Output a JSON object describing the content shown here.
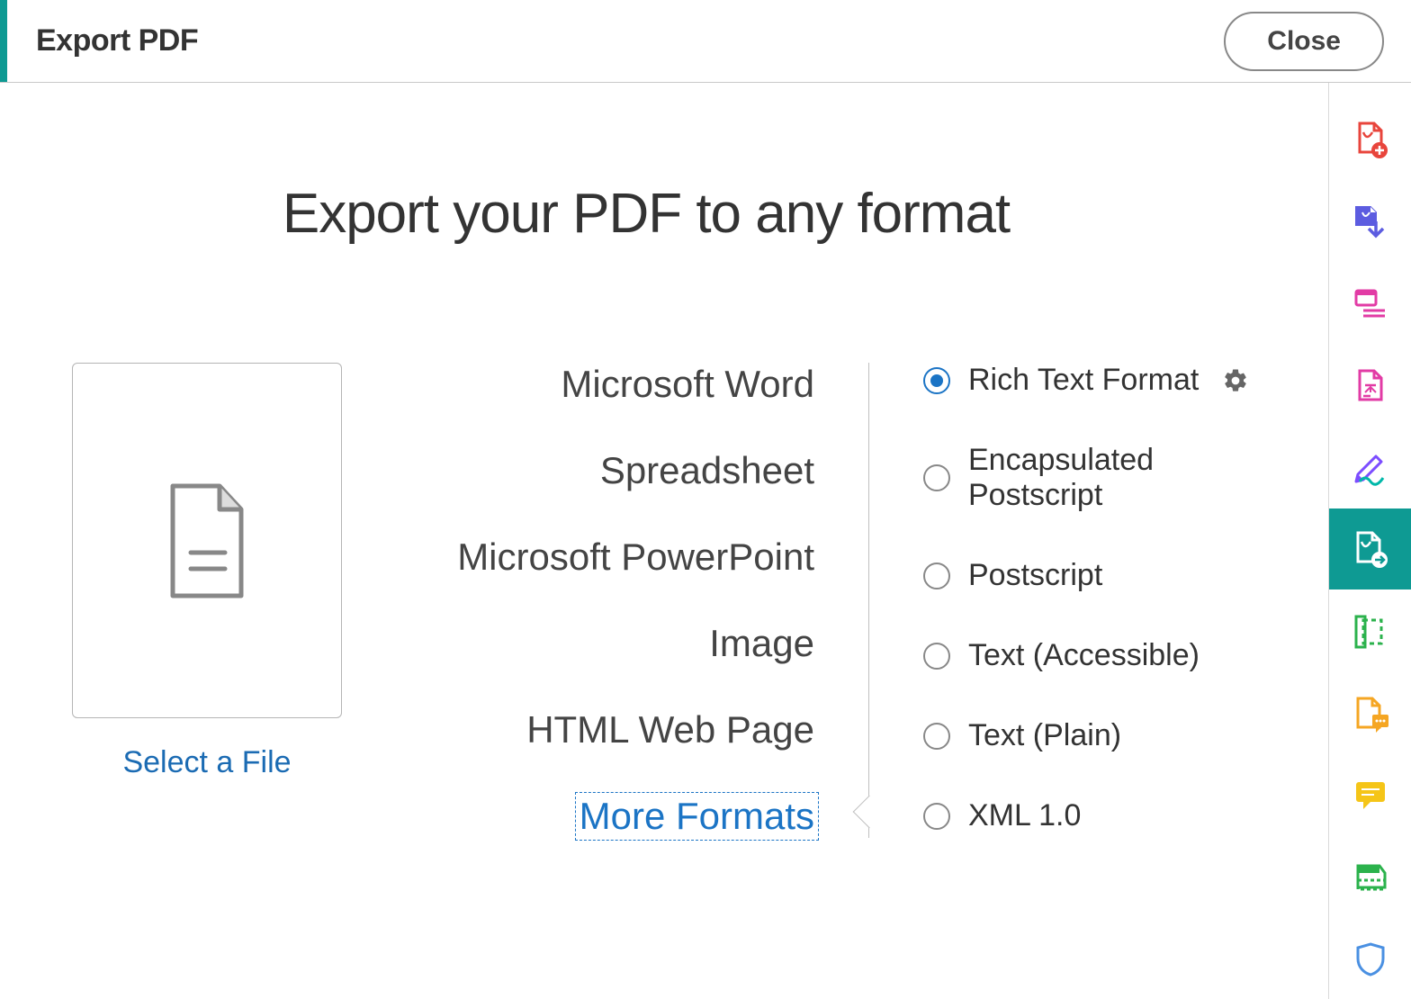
{
  "header": {
    "title": "Export PDF",
    "close_label": "Close"
  },
  "main": {
    "heading": "Export your PDF to any format",
    "select_file_label": "Select a File",
    "categories": [
      {
        "label": "Microsoft Word",
        "selected": false
      },
      {
        "label": "Spreadsheet",
        "selected": false
      },
      {
        "label": "Microsoft PowerPoint",
        "selected": false
      },
      {
        "label": "Image",
        "selected": false
      },
      {
        "label": "HTML Web Page",
        "selected": false
      },
      {
        "label": "More Formats",
        "selected": true
      }
    ],
    "options": [
      {
        "label": "Rich Text Format",
        "checked": true,
        "has_settings": true
      },
      {
        "label": "Encapsulated Postscript",
        "checked": false,
        "has_settings": false
      },
      {
        "label": "Postscript",
        "checked": false,
        "has_settings": false
      },
      {
        "label": "Text (Accessible)",
        "checked": false,
        "has_settings": false
      },
      {
        "label": "Text (Plain)",
        "checked": false,
        "has_settings": false
      },
      {
        "label": "XML 1.0",
        "checked": false,
        "has_settings": false
      }
    ]
  },
  "tool_rail": {
    "items": [
      {
        "name": "create-pdf-icon",
        "active": false
      },
      {
        "name": "combine-files-icon",
        "active": false
      },
      {
        "name": "organize-pages-icon",
        "active": false
      },
      {
        "name": "edit-pdf-icon",
        "active": false
      },
      {
        "name": "sign-icon",
        "active": false
      },
      {
        "name": "export-pdf-icon",
        "active": true
      },
      {
        "name": "crop-icon",
        "active": false
      },
      {
        "name": "comment-icon",
        "active": false
      },
      {
        "name": "chat-icon",
        "active": false
      },
      {
        "name": "scan-icon",
        "active": false
      },
      {
        "name": "protect-icon",
        "active": false
      }
    ]
  }
}
